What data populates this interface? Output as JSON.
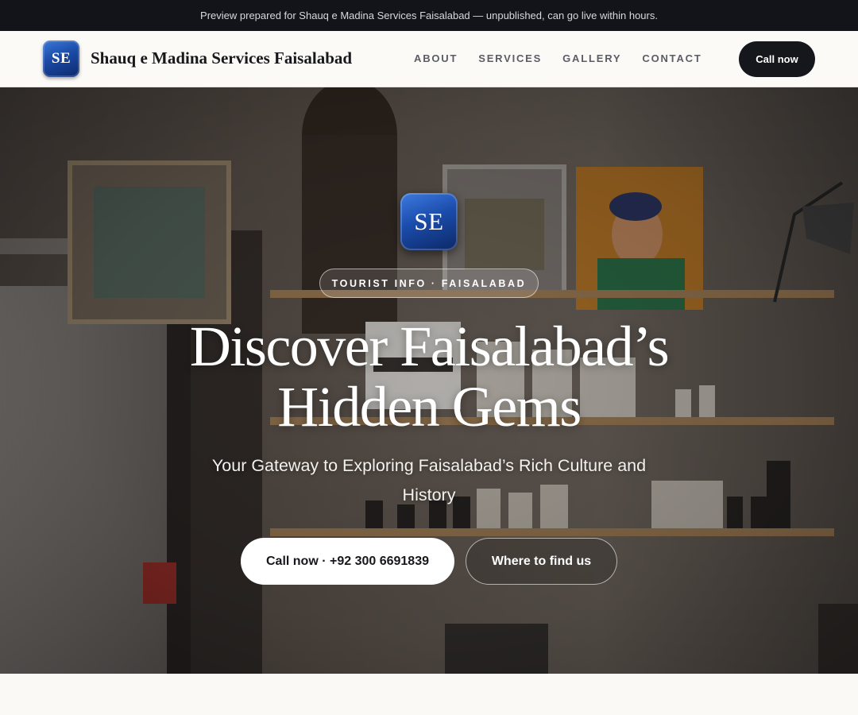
{
  "announcement": {
    "text": "Preview prepared for Shauq e Madina Services Faisalabad — unpublished, can go live within hours."
  },
  "header": {
    "logo_initials": "SE",
    "brand_name": "Shauq e Madina Services Faisalabad",
    "nav": [
      {
        "label": "ABOUT"
      },
      {
        "label": "SERVICES"
      },
      {
        "label": "GALLERY"
      },
      {
        "label": "CONTACT"
      }
    ],
    "cta_label": "Call now"
  },
  "hero": {
    "logo_initials": "SE",
    "tag": "TOURIST INFO · FAISALABAD",
    "title_line1": "Discover Faisalabad’s",
    "title_line2": "Hidden Gems",
    "subtitle": "Your Gateway to Exploring Faisalabad’s Rich Culture and History",
    "primary_button": "Call now · +92 300 6691839",
    "secondary_button": "Where to find us",
    "background_image": "shop-interior-photo"
  },
  "colors": {
    "topbar_bg": "#12141a",
    "nav_bg": "#fbfaf7",
    "dark_button": "#16171c",
    "logo_blue": "#1a4aa6",
    "page_bg": "#faf9f6"
  }
}
